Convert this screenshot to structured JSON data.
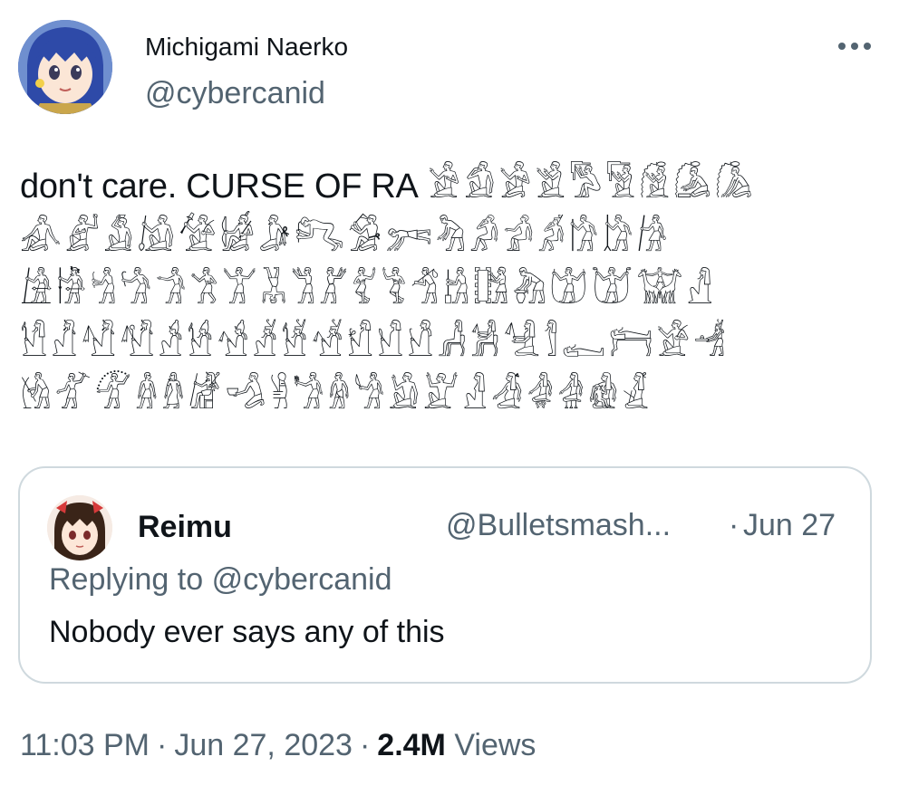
{
  "author": {
    "display_name": "Michigami Naerko",
    "handle": "@cybercanid",
    "avatar_icon": "anime-avatar-icon"
  },
  "tweet": {
    "text_lead": "don't care. CURSE OF RA",
    "hieroglyphs_line1": "𓀀𓀁𓀂𓀃𓀄𓀅𓀆𓀇𓀈",
    "hieroglyphs_line2": "𓀉𓀊𓀋𓀌𓀍𓀎𓀏𓀐𓀑𓀒𓀓𓀔𓀕𓀖𓀗𓀘𓀙",
    "hieroglyphs_line3": "𓀚𓀛𓀜𓀝𓀞𓀟𓀠𓀡𓀢𓀣𓀤𓀥𓀦𓀧𓀨𓀩𓀪𓀫𓀬𓀭",
    "hieroglyphs_line4": "𓀮𓀯𓀰𓀱𓀲𓀳𓀴𓀵𓀶𓀷𓀸𓀹𓀺𓀻𓀼𓀽𓀾𓀿𓁀𓁁𓁂",
    "hieroglyphs_line5": "𓁃𓁄𓁅𓁆𓁇𓁈𓁉𓁊𓁋𓁌𓁍𓁎𓁏𓁐𓁑𓁒𓁓𓁔𓁕"
  },
  "quote": {
    "name": "Reimu",
    "handle": "@Bulletsmash...",
    "separator": "·",
    "date": "Jun 27",
    "replying_prefix": "Replying to",
    "replying_to": "@cybercanid",
    "text": "Nobody ever says any of this"
  },
  "meta": {
    "time": "11:03 PM",
    "dot": "·",
    "date": "Jun 27, 2023",
    "views_count": "2.4M",
    "views_label": "Views"
  },
  "colors": {
    "text_primary": "#0f1419",
    "text_secondary": "#536471",
    "border": "#cfd9de"
  },
  "icons": {
    "more": "more-dots-icon"
  }
}
